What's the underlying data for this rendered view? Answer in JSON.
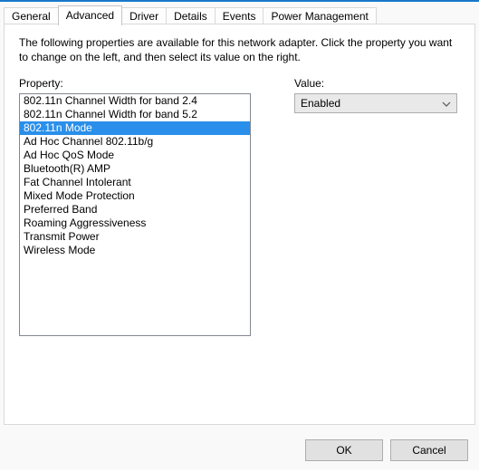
{
  "tabs": [
    {
      "label": "General"
    },
    {
      "label": "Advanced"
    },
    {
      "label": "Driver"
    },
    {
      "label": "Details"
    },
    {
      "label": "Events"
    },
    {
      "label": "Power Management"
    }
  ],
  "active_tab_index": 1,
  "intro_text": "The following properties are available for this network adapter. Click the property you want to change on the left, and then select its value on the right.",
  "property_label": "Property:",
  "value_label": "Value:",
  "properties": [
    "802.11n Channel Width for band 2.4",
    "802.11n Channel Width for band 5.2",
    "802.11n Mode",
    "Ad Hoc Channel 802.11b/g",
    "Ad Hoc QoS Mode",
    "Bluetooth(R) AMP",
    "Fat Channel Intolerant",
    "Mixed Mode Protection",
    "Preferred Band",
    "Roaming Aggressiveness",
    "Transmit Power",
    "Wireless Mode"
  ],
  "selected_property_index": 2,
  "value_selected": "Enabled",
  "buttons": {
    "ok": "OK",
    "cancel": "Cancel"
  },
  "annotation_color": "#ff3b1f"
}
